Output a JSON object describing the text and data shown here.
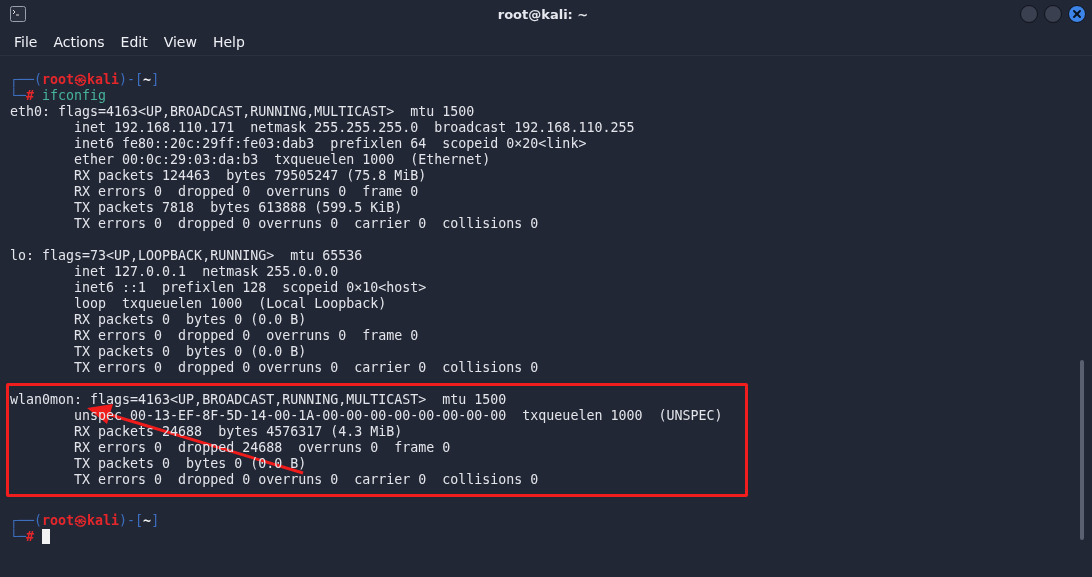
{
  "window": {
    "title": "root@kali: ~"
  },
  "menu": [
    "File",
    "Actions",
    "Edit",
    "View",
    "Help"
  ],
  "terminal": [
    {
      "kind": "prompt",
      "top": [
        {
          "kind": "frame",
          "text": "┌──("
        },
        {
          "kind": "user",
          "text": "root㉿kali"
        },
        {
          "kind": "frame",
          "text": ")-["
        },
        {
          "kind": "dir",
          "text": "~"
        },
        {
          "kind": "frame",
          "text": "]"
        }
      ],
      "bottom": [
        {
          "kind": "frame",
          "text": "└─"
        },
        {
          "kind": "symbol",
          "text": "#"
        },
        {
          "kind": "command",
          "text": " ifconfig"
        }
      ],
      "cursor": false
    },
    {
      "kind": "output",
      "highlighted": false,
      "lines": [
        "eth0: flags=4163<UP,BROADCAST,RUNNING,MULTICAST>  mtu 1500",
        "        inet 192.168.110.171  netmask 255.255.255.0  broadcast 192.168.110.255",
        "        inet6 fe80::20c:29ff:fe03:dab3  prefixlen 64  scopeid 0×20<link>",
        "        ether 00:0c:29:03:da:b3  txqueuelen 1000  (Ethernet)",
        "        RX packets 124463  bytes 79505247 (75.8 MiB)",
        "        RX errors 0  dropped 0  overruns 0  frame 0",
        "        TX packets 7818  bytes 613888 (599.5 KiB)",
        "        TX errors 0  dropped 0 overruns 0  carrier 0  collisions 0"
      ]
    },
    {
      "kind": "output",
      "highlighted": false,
      "lines": [
        "lo: flags=73<UP,LOOPBACK,RUNNING>  mtu 65536",
        "        inet 127.0.0.1  netmask 255.0.0.0",
        "        inet6 ::1  prefixlen 128  scopeid 0×10<host>",
        "        loop  txqueuelen 1000  (Local Loopback)",
        "        RX packets 0  bytes 0 (0.0 B)",
        "        RX errors 0  dropped 0  overruns 0  frame 0",
        "        TX packets 0  bytes 0 (0.0 B)",
        "        TX errors 0  dropped 0 overruns 0  carrier 0  collisions 0"
      ]
    },
    {
      "kind": "output",
      "highlighted": true,
      "lines": [
        "wlan0mon: flags=4163<UP,BROADCAST,RUNNING,MULTICAST>  mtu 1500",
        "        unspec 00-13-EF-8F-5D-14-00-1A-00-00-00-00-00-00-00-00  txqueuelen 1000  (UNSPEC)",
        "        RX packets 24688  bytes 4576317 (4.3 MiB)",
        "        RX errors 0  dropped 24688  overruns 0  frame 0",
        "        TX packets 0  bytes 0 (0.0 B)",
        "        TX errors 0  dropped 0 overruns 0  carrier 0  collisions 0"
      ]
    },
    {
      "kind": "prompt",
      "top": [
        {
          "kind": "frame",
          "text": "┌──("
        },
        {
          "kind": "user",
          "text": "root㉿kali"
        },
        {
          "kind": "frame",
          "text": ")-["
        },
        {
          "kind": "dir",
          "text": "~"
        },
        {
          "kind": "frame",
          "text": "]"
        }
      ],
      "bottom": [
        {
          "kind": "frame",
          "text": "└─"
        },
        {
          "kind": "symbol",
          "text": "#"
        }
      ],
      "cursor": true
    }
  ]
}
